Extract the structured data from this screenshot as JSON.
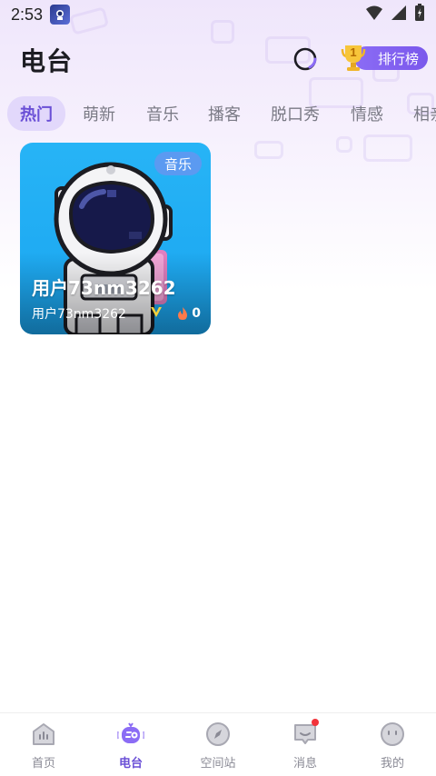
{
  "status_bar": {
    "time": "2:53",
    "app_icon": "astronaut-app-icon"
  },
  "header": {
    "title": "电台",
    "rank_label": "排行榜",
    "rank_badge": "1"
  },
  "tabs": [
    {
      "label": "热门",
      "active": true
    },
    {
      "label": "萌新",
      "active": false
    },
    {
      "label": "音乐",
      "active": false
    },
    {
      "label": "播客",
      "active": false
    },
    {
      "label": "脱口秀",
      "active": false
    },
    {
      "label": "情感",
      "active": false
    },
    {
      "label": "相亲",
      "active": false
    }
  ],
  "cards": [
    {
      "tag": "音乐",
      "title": "用户73nm3262",
      "user": "用户73nm3262",
      "heat": "0",
      "bg_color": "#1ea8f2"
    }
  ],
  "bottom_nav": [
    {
      "label": "首页",
      "icon": "home-icon",
      "active": false
    },
    {
      "label": "电台",
      "icon": "radio-icon",
      "active": true
    },
    {
      "label": "空间站",
      "icon": "compass-icon",
      "active": false
    },
    {
      "label": "消息",
      "icon": "message-icon",
      "active": false,
      "has_dot": true
    },
    {
      "label": "我的",
      "icon": "profile-icon",
      "active": false
    }
  ],
  "colors": {
    "accent": "#7a58ec",
    "active_tab_bg": "#e2d8fb",
    "badge_red": "#f2333a"
  }
}
